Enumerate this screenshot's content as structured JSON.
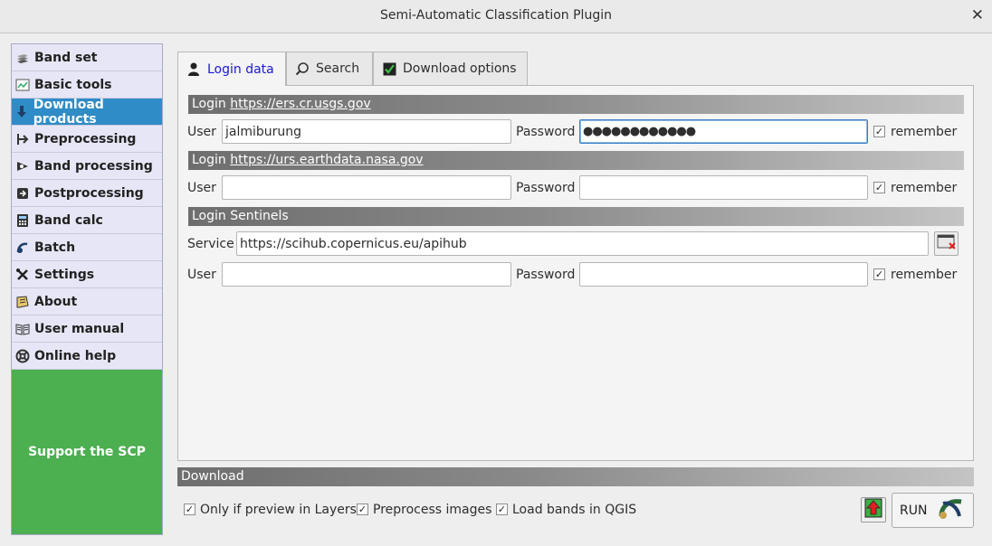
{
  "window": {
    "title": "Semi-Automatic Classification Plugin"
  },
  "sidebar": {
    "items": [
      {
        "label": "Band set",
        "icon": "band-set-icon"
      },
      {
        "label": "Basic tools",
        "icon": "basic-tools-icon"
      },
      {
        "label": "Download products",
        "icon": "download-icon",
        "active": true
      },
      {
        "label": "Preprocessing",
        "icon": "preprocessing-icon"
      },
      {
        "label": "Band processing",
        "icon": "band-processing-icon"
      },
      {
        "label": "Postprocessing",
        "icon": "postprocessing-icon"
      },
      {
        "label": "Band calc",
        "icon": "band-calc-icon"
      },
      {
        "label": "Batch",
        "icon": "batch-icon"
      },
      {
        "label": "Settings",
        "icon": "settings-icon"
      },
      {
        "label": "About",
        "icon": "about-icon"
      },
      {
        "label": "User manual",
        "icon": "user-manual-icon"
      },
      {
        "label": "Online help",
        "icon": "online-help-icon"
      }
    ],
    "support_label": "Support the SCP"
  },
  "tabs": [
    {
      "label": "Login data",
      "icon": "user-icon",
      "active": true
    },
    {
      "label": "Search",
      "icon": "search-icon"
    },
    {
      "label": "Download options",
      "icon": "checkbox-icon"
    }
  ],
  "login_usgs": {
    "prefix": "Login ",
    "url": "https://ers.cr.usgs.gov",
    "user_label": "User",
    "user_value": "jalmiburung",
    "password_label": "Password",
    "password_value": "●●●●●●●●●●●●",
    "remember_label": "remember",
    "remember_checked": true
  },
  "login_earthdata": {
    "prefix": "Login ",
    "url": "https://urs.earthdata.nasa.gov",
    "user_label": "User",
    "user_value": "",
    "password_label": "Password",
    "password_value": "",
    "remember_label": "remember",
    "remember_checked": true
  },
  "login_sentinels": {
    "title": "Login Sentinels",
    "service_label": "Service",
    "service_value": "https://scihub.copernicus.eu/apihub",
    "user_label": "User",
    "user_value": "",
    "password_label": "Password",
    "password_value": "",
    "remember_label": "remember",
    "remember_checked": true
  },
  "download": {
    "title": "Download",
    "options": [
      {
        "label": "Only if preview in Layers",
        "checked": true
      },
      {
        "label": "Preprocess images",
        "checked": true
      },
      {
        "label": "Load bands in QGIS",
        "checked": true
      }
    ],
    "run_label": "RUN"
  },
  "colors": {
    "active_item": "#308cc6",
    "support_bg": "#4caf50",
    "active_tab_text": "#1a1acd"
  }
}
